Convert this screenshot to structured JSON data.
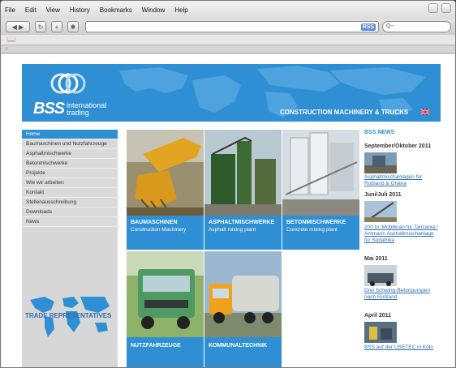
{
  "browser": {
    "menu": [
      "File",
      "Edit",
      "View",
      "History",
      "Bookmarks",
      "Window",
      "Help"
    ],
    "rss_badge": "RSS",
    "search_glyph": "Q~"
  },
  "header": {
    "brand_main": "BSS",
    "brand_sub_1": "international",
    "brand_sub_2": "trading",
    "tagline": "CONSTRUCTION MACHINERY & TRUCKS",
    "accent_color": "#2e8fd4"
  },
  "nav": {
    "items": [
      "Home",
      "Baumaschinen und Nutzfahrzeuge",
      "Asphaltmischwerke",
      "Betonmischwerke",
      "Projekte",
      "Wie wir arbeiten",
      "Kontakt",
      "Stellenausschreibung",
      "Downloads",
      "News"
    ],
    "active": "Home"
  },
  "trade_label": "TRADE REPRESENTATIVES",
  "tiles": [
    {
      "title": "BAUMASCHINEN",
      "subtitle": "Construction Machinery"
    },
    {
      "title": "ASPHALTMISCHWERKE",
      "subtitle": "Asphalt mixing plant"
    },
    {
      "title": "BETONMISCHWERKE",
      "subtitle": "Concrete mixing plant"
    },
    {
      "title": "NUTZFAHRZEUGE",
      "subtitle": ""
    },
    {
      "title": "KOMMUNALTECHNIK",
      "subtitle": ""
    }
  ],
  "news": {
    "heading": "BSS NEWS",
    "entries": [
      {
        "date": "September/Oktober 2011",
        "link": "Asphaltmischanlagen für Rußland & Ghana"
      },
      {
        "date": "Juni/Juli 2011",
        "link": "200 to. Mobilkran für Tanzania / Ammann Asphaltmischanlage für Südafrika"
      },
      {
        "date": "Mai 2011",
        "link": "Drei Schwing-Betonpumpen nach Rußland"
      },
      {
        "date": "April 2011",
        "link": "BSS auf der USETEC in Köln"
      }
    ]
  }
}
